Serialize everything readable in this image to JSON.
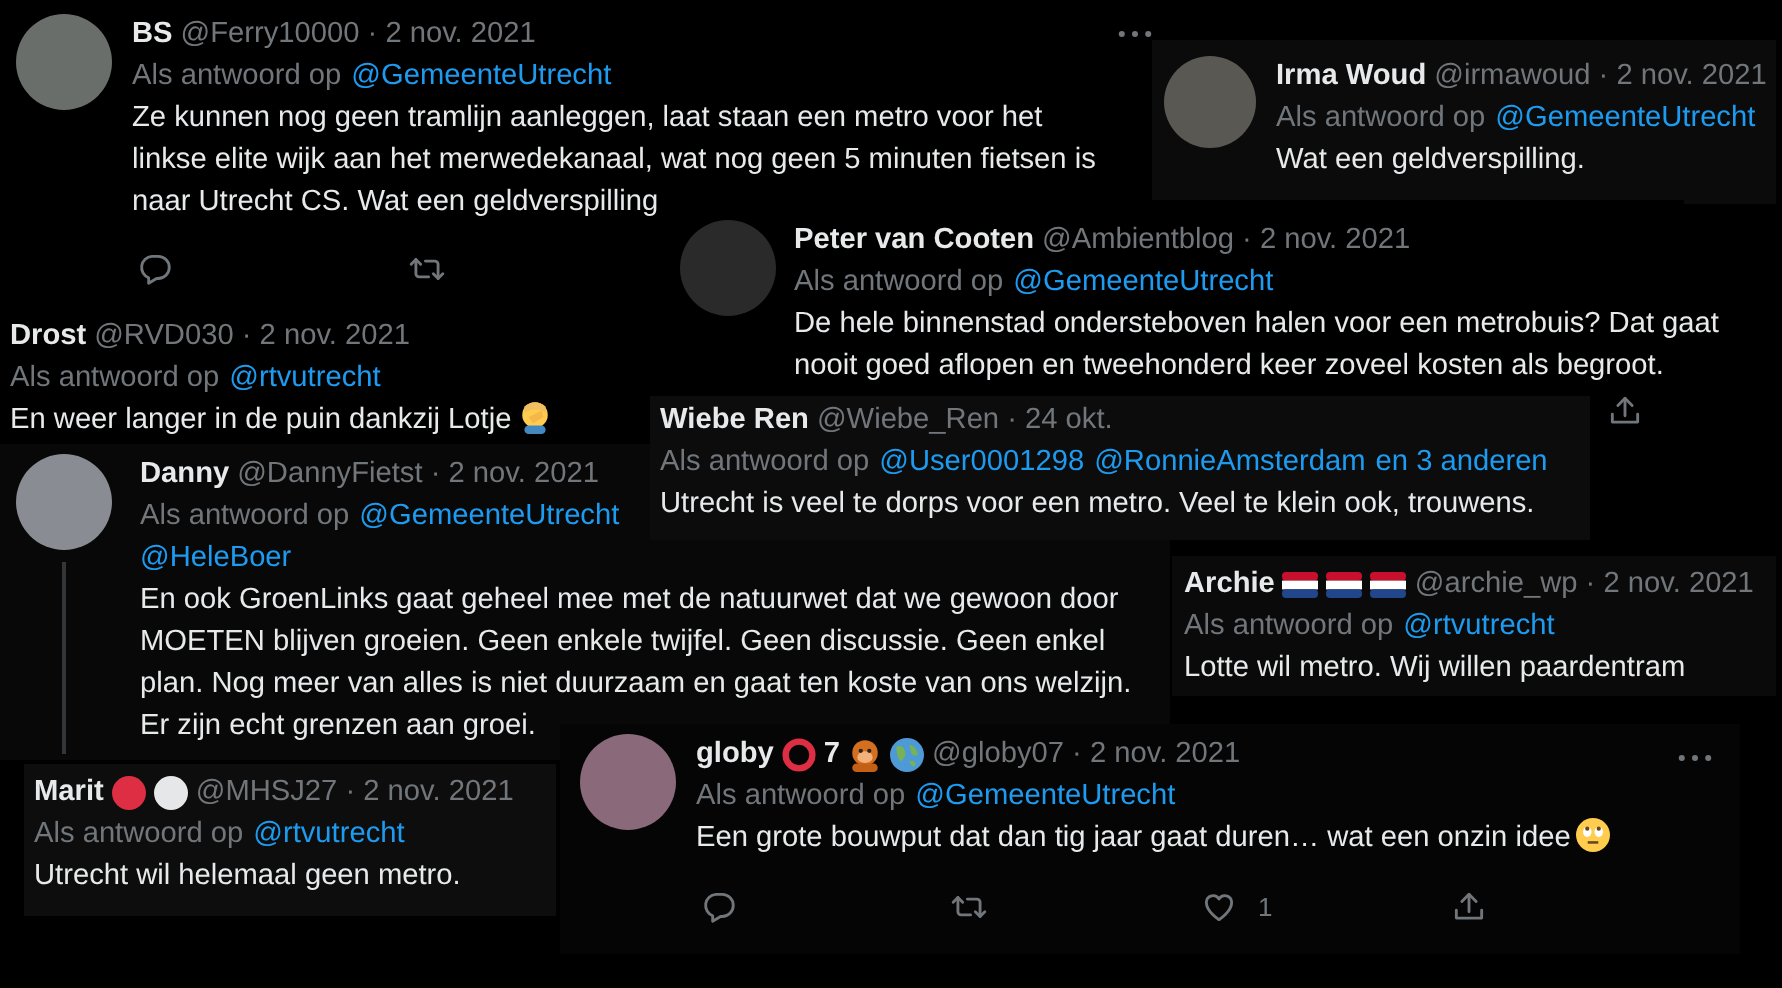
{
  "tweets": [
    {
      "name": "BS",
      "meta": "@Ferry10000 · 2 nov. 2021",
      "more_menu": true,
      "reply_to": {
        "label": "Als antwoord op",
        "links": [
          "@GemeenteUtrecht"
        ]
      },
      "body": "Ze kunnen nog geen tramlijn aanleggen, laat staan een metro voor het linkse elite wijk aan het merwedekanaal, wat nog geen 5 minuten fietsen is naar Utrecht CS. Wat een geldverspilling",
      "actions": [
        {
          "kind": "reply"
        },
        {
          "kind": "retweet"
        }
      ]
    },
    {
      "name": "Irma Woud",
      "meta": "@irmawoud · 2 nov. 2021",
      "reply_to": {
        "label": "Als antwoord op",
        "links": [
          "@GemeenteUtrecht"
        ]
      },
      "body": "Wat een geldverspilling."
    },
    {
      "name": "Peter van Cooten",
      "meta": "@Ambientblog · 2 nov. 2021",
      "reply_to": {
        "label": "Als antwoord op",
        "links": [
          "@GemeenteUtrecht"
        ]
      },
      "body": "De hele binnenstad ondersteboven halen voor een metrobuis? Dat gaat nooit goed aflopen en tweehonderd keer zoveel kosten als begroot.",
      "actions": [
        {
          "kind": "share"
        }
      ]
    },
    {
      "name": "Drost",
      "meta": "@RVD030 · 2 nov. 2021",
      "reply_to": {
        "label": "Als antwoord op",
        "links": [
          "@rtvutrecht"
        ]
      },
      "body": "En weer langer in de puin dankzij Lotje",
      "body_extras": [
        {
          "kind": "facepalm"
        }
      ]
    },
    {
      "name": "Wiebe Ren",
      "meta": "@Wiebe_Ren · 24 okt.",
      "reply_to": {
        "label": "Als antwoord op",
        "links": [
          "@User0001298",
          "@RonnieAmsterdam",
          "en 3 anderen"
        ]
      },
      "body": "Utrecht is veel te dorps voor een metro. Veel te klein ook, trouwens."
    },
    {
      "name": "Danny",
      "meta": "@DannyFietst · 2 nov. 2021",
      "thread_line": true,
      "reply_to": {
        "label": "Als antwoord op",
        "links": [
          "@GemeenteUtrecht"
        ]
      },
      "mention_line": "@HeleBoer",
      "body": "En ook GroenLinks gaat geheel mee met de natuurwet dat we gewoon door MOETEN blijven groeien. Geen enkele twijfel. Geen discussie. Geen enkel plan. Nog meer van alles is niet duurzaam en gaat ten koste van ons welzijn. Er zijn echt grenzen aan groei."
    },
    {
      "name": "Archie",
      "name_extras": [
        {
          "kind": "flag"
        },
        {
          "kind": "flag"
        },
        {
          "kind": "flag"
        }
      ],
      "meta": "@archie_wp · 2 nov. 2021",
      "reply_to": {
        "label": "Als antwoord op",
        "links": [
          "@rtvutrecht"
        ]
      },
      "body": "Lotte wil metro. Wij willen paardentram"
    },
    {
      "name": "Marit",
      "name_extras": [
        {
          "kind": "red-dot"
        },
        {
          "kind": "white-dot"
        }
      ],
      "meta": "@MHSJ27 · 2 nov. 2021",
      "reply_to": {
        "label": "Als antwoord op",
        "links": [
          "@rtvutrecht"
        ]
      },
      "body": "Utrecht wil helemaal geen metro."
    },
    {
      "name": "globy",
      "name_extras": [
        {
          "kind": "ring"
        },
        {
          "kind": "text",
          "text": "7"
        },
        {
          "kind": "orangutan"
        },
        {
          "kind": "globe"
        }
      ],
      "meta": "@globy07 · 2 nov. 2021",
      "more_menu": true,
      "reply_to": {
        "label": "Als antwoord op",
        "links": [
          "@GemeenteUtrecht"
        ]
      },
      "body": "Een grote bouwput dat dan tig jaar gaat duren… wat een onzin idee",
      "body_extras": [
        {
          "kind": "rolling-eyes"
        }
      ],
      "actions": [
        {
          "kind": "reply"
        },
        {
          "kind": "retweet"
        },
        {
          "kind": "like",
          "count": "1"
        },
        {
          "kind": "share"
        }
      ]
    }
  ]
}
